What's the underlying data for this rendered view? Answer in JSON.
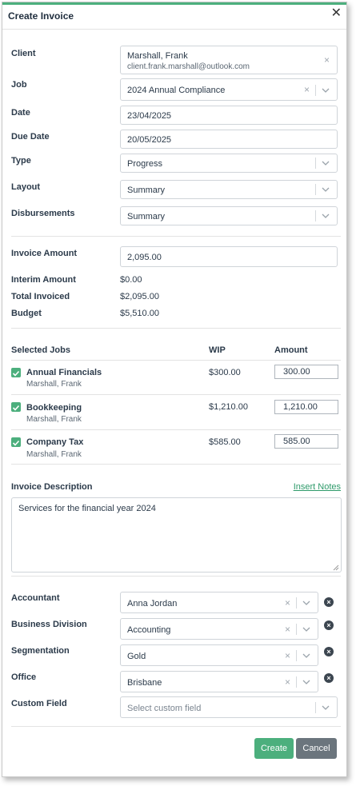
{
  "dialog": {
    "title": "Create Invoice"
  },
  "form": {
    "client": {
      "label": "Client",
      "name": "Marshall, Frank",
      "email": "client.frank.marshall@outlook.com"
    },
    "job": {
      "label": "Job",
      "value": "2024 Annual Compliance"
    },
    "date": {
      "label": "Date",
      "value": "23/04/2025"
    },
    "due_date": {
      "label": "Due Date",
      "value": "20/05/2025"
    },
    "type": {
      "label": "Type",
      "value": "Progress"
    },
    "layout": {
      "label": "Layout",
      "value": "Summary"
    },
    "disbursements": {
      "label": "Disbursements",
      "value": "Summary"
    }
  },
  "amounts": {
    "invoice_amount": {
      "label": "Invoice Amount",
      "value": "2,095.00"
    },
    "interim_amount": {
      "label": "Interim Amount",
      "value": "$0.00"
    },
    "total_invoiced": {
      "label": "Total Invoiced",
      "value": "$2,095.00"
    },
    "budget": {
      "label": "Budget",
      "value": "$5,510.00"
    }
  },
  "jobs_table": {
    "headers": {
      "selected": "Selected Jobs",
      "wip": "WIP",
      "amount": "Amount"
    },
    "rows": [
      {
        "name": "Annual Financials",
        "client": "Marshall, Frank",
        "wip": "$300.00",
        "amount": "300.00",
        "checked": true
      },
      {
        "name": "Bookkeeping",
        "client": "Marshall, Frank",
        "wip": "$1,210.00",
        "amount": "1,210.00",
        "checked": true
      },
      {
        "name": "Company Tax",
        "client": "Marshall, Frank",
        "wip": "$585.00",
        "amount": "585.00",
        "checked": true
      }
    ]
  },
  "description": {
    "label": "Invoice Description",
    "insert_notes": "Insert Notes",
    "value": "Services for the financial year 2024"
  },
  "custom": {
    "accountant": {
      "label": "Accountant",
      "value": "Anna Jordan"
    },
    "business_division": {
      "label": "Business Division",
      "value": "Accounting"
    },
    "segmentation": {
      "label": "Segmentation",
      "value": "Gold"
    },
    "office": {
      "label": "Office",
      "value": "Brisbane"
    },
    "custom_field": {
      "label": "Custom Field",
      "placeholder": "Select custom field"
    }
  },
  "actions": {
    "create": "Create",
    "cancel": "Cancel"
  },
  "colors": {
    "accent": "#4caf7d",
    "cancel": "#6b757d",
    "link": "#2e9a6a"
  },
  "icons": {
    "close": "close-icon",
    "clear": "clear-x-icon",
    "chevron": "chevron-down-icon",
    "check": "checkbox-checked-icon",
    "remove": "remove-circle-x-icon"
  }
}
